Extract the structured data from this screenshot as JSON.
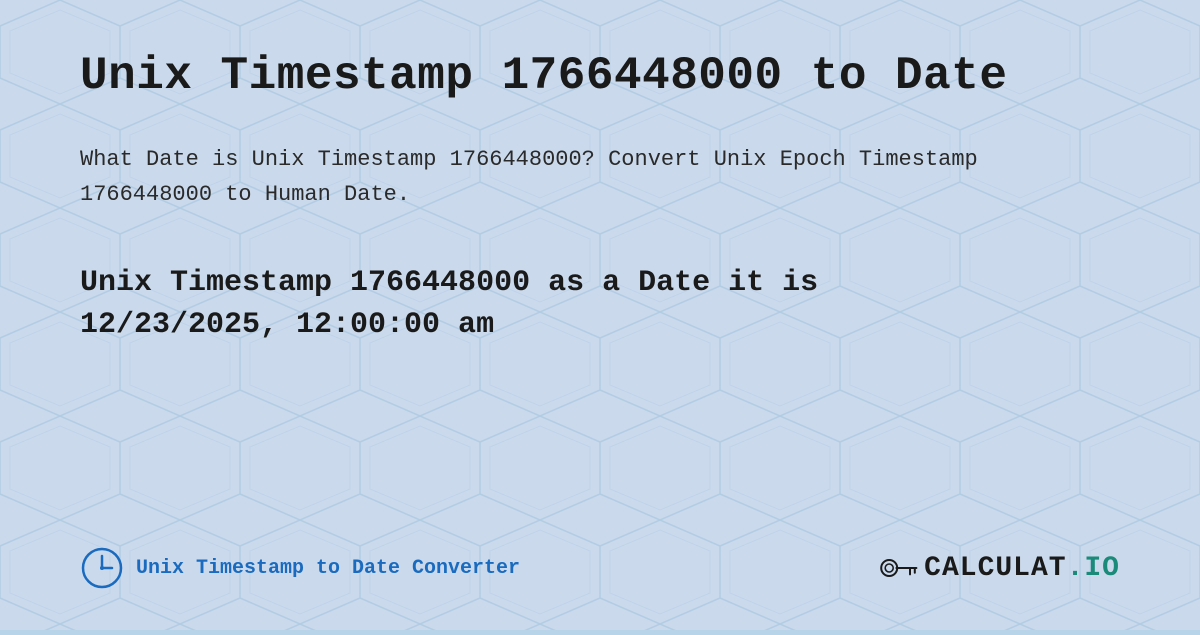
{
  "page": {
    "title": "Unix Timestamp 1766448000 to Date",
    "description": "What Date is Unix Timestamp 1766448000? Convert Unix Epoch Timestamp 1766448000 to Human Date.",
    "result_line1": "Unix Timestamp 1766448000 as a Date it is",
    "result_line2": "12/23/2025, 12:00:00 am",
    "footer": {
      "link_text": "Unix Timestamp to Date Converter",
      "logo_text_1": "CALCULAT",
      "logo_text_2": ".IO"
    },
    "background_color": "#c5daf0",
    "accent_color": "#1a6bbf"
  }
}
